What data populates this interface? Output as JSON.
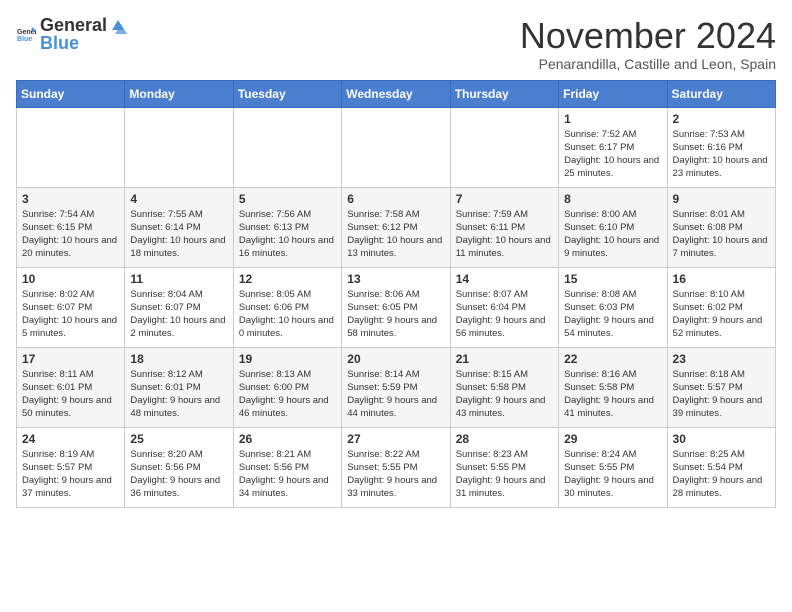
{
  "header": {
    "logo_general": "General",
    "logo_blue": "Blue",
    "month_title": "November 2024",
    "location": "Penarandilla, Castille and Leon, Spain"
  },
  "calendar": {
    "days_of_week": [
      "Sunday",
      "Monday",
      "Tuesday",
      "Wednesday",
      "Thursday",
      "Friday",
      "Saturday"
    ],
    "weeks": [
      [
        {
          "day": "",
          "info": ""
        },
        {
          "day": "",
          "info": ""
        },
        {
          "day": "",
          "info": ""
        },
        {
          "day": "",
          "info": ""
        },
        {
          "day": "",
          "info": ""
        },
        {
          "day": "1",
          "info": "Sunrise: 7:52 AM\nSunset: 6:17 PM\nDaylight: 10 hours and 25 minutes."
        },
        {
          "day": "2",
          "info": "Sunrise: 7:53 AM\nSunset: 6:16 PM\nDaylight: 10 hours and 23 minutes."
        }
      ],
      [
        {
          "day": "3",
          "info": "Sunrise: 7:54 AM\nSunset: 6:15 PM\nDaylight: 10 hours and 20 minutes."
        },
        {
          "day": "4",
          "info": "Sunrise: 7:55 AM\nSunset: 6:14 PM\nDaylight: 10 hours and 18 minutes."
        },
        {
          "day": "5",
          "info": "Sunrise: 7:56 AM\nSunset: 6:13 PM\nDaylight: 10 hours and 16 minutes."
        },
        {
          "day": "6",
          "info": "Sunrise: 7:58 AM\nSunset: 6:12 PM\nDaylight: 10 hours and 13 minutes."
        },
        {
          "day": "7",
          "info": "Sunrise: 7:59 AM\nSunset: 6:11 PM\nDaylight: 10 hours and 11 minutes."
        },
        {
          "day": "8",
          "info": "Sunrise: 8:00 AM\nSunset: 6:10 PM\nDaylight: 10 hours and 9 minutes."
        },
        {
          "day": "9",
          "info": "Sunrise: 8:01 AM\nSunset: 6:08 PM\nDaylight: 10 hours and 7 minutes."
        }
      ],
      [
        {
          "day": "10",
          "info": "Sunrise: 8:02 AM\nSunset: 6:07 PM\nDaylight: 10 hours and 5 minutes."
        },
        {
          "day": "11",
          "info": "Sunrise: 8:04 AM\nSunset: 6:07 PM\nDaylight: 10 hours and 2 minutes."
        },
        {
          "day": "12",
          "info": "Sunrise: 8:05 AM\nSunset: 6:06 PM\nDaylight: 10 hours and 0 minutes."
        },
        {
          "day": "13",
          "info": "Sunrise: 8:06 AM\nSunset: 6:05 PM\nDaylight: 9 hours and 58 minutes."
        },
        {
          "day": "14",
          "info": "Sunrise: 8:07 AM\nSunset: 6:04 PM\nDaylight: 9 hours and 56 minutes."
        },
        {
          "day": "15",
          "info": "Sunrise: 8:08 AM\nSunset: 6:03 PM\nDaylight: 9 hours and 54 minutes."
        },
        {
          "day": "16",
          "info": "Sunrise: 8:10 AM\nSunset: 6:02 PM\nDaylight: 9 hours and 52 minutes."
        }
      ],
      [
        {
          "day": "17",
          "info": "Sunrise: 8:11 AM\nSunset: 6:01 PM\nDaylight: 9 hours and 50 minutes."
        },
        {
          "day": "18",
          "info": "Sunrise: 8:12 AM\nSunset: 6:01 PM\nDaylight: 9 hours and 48 minutes."
        },
        {
          "day": "19",
          "info": "Sunrise: 8:13 AM\nSunset: 6:00 PM\nDaylight: 9 hours and 46 minutes."
        },
        {
          "day": "20",
          "info": "Sunrise: 8:14 AM\nSunset: 5:59 PM\nDaylight: 9 hours and 44 minutes."
        },
        {
          "day": "21",
          "info": "Sunrise: 8:15 AM\nSunset: 5:58 PM\nDaylight: 9 hours and 43 minutes."
        },
        {
          "day": "22",
          "info": "Sunrise: 8:16 AM\nSunset: 5:58 PM\nDaylight: 9 hours and 41 minutes."
        },
        {
          "day": "23",
          "info": "Sunrise: 8:18 AM\nSunset: 5:57 PM\nDaylight: 9 hours and 39 minutes."
        }
      ],
      [
        {
          "day": "24",
          "info": "Sunrise: 8:19 AM\nSunset: 5:57 PM\nDaylight: 9 hours and 37 minutes."
        },
        {
          "day": "25",
          "info": "Sunrise: 8:20 AM\nSunset: 5:56 PM\nDaylight: 9 hours and 36 minutes."
        },
        {
          "day": "26",
          "info": "Sunrise: 8:21 AM\nSunset: 5:56 PM\nDaylight: 9 hours and 34 minutes."
        },
        {
          "day": "27",
          "info": "Sunrise: 8:22 AM\nSunset: 5:55 PM\nDaylight: 9 hours and 33 minutes."
        },
        {
          "day": "28",
          "info": "Sunrise: 8:23 AM\nSunset: 5:55 PM\nDaylight: 9 hours and 31 minutes."
        },
        {
          "day": "29",
          "info": "Sunrise: 8:24 AM\nSunset: 5:55 PM\nDaylight: 9 hours and 30 minutes."
        },
        {
          "day": "30",
          "info": "Sunrise: 8:25 AM\nSunset: 5:54 PM\nDaylight: 9 hours and 28 minutes."
        }
      ]
    ]
  }
}
